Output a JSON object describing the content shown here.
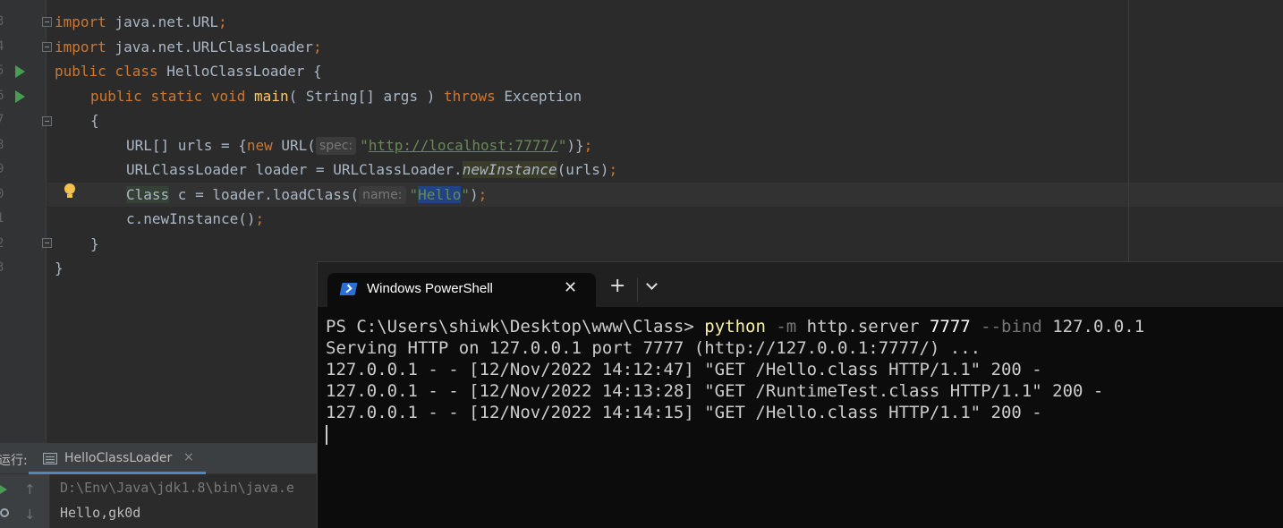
{
  "editor": {
    "line_numbers": [
      "3",
      "4",
      "5",
      "6",
      "7",
      "8",
      "9",
      "0",
      "1",
      "2",
      "3"
    ],
    "code": {
      "l1": {
        "kw": "import",
        "rest": " java.net.URL",
        "semi": ";"
      },
      "l2": {
        "kw": "import",
        "rest": " java.net.URLClassLoader",
        "semi": ";"
      },
      "l3": {
        "kw1": "public",
        "kw2": "class",
        "rest": " HelloClassLoader {"
      },
      "l4": {
        "kw1": "public",
        "kw2": "static",
        "kw3": "void",
        "fn": "main",
        "args": "( String[] args ) ",
        "throws": "throws",
        "rest": " Exception"
      },
      "l5": {
        "text": "{"
      },
      "l6": {
        "pre": "URL[] urls = {",
        "kw": "new",
        "mid": " URL(",
        "hint": "spec:",
        "url": "http://localhost:7777/",
        "quote_open": "\"",
        "quote_close": "\"",
        "post": ")}",
        "semi": ";"
      },
      "l7": {
        "pre": "URLClassLoader loader = URLClassLoader.",
        "method": "newInstance",
        "post": "(urls)",
        "semi": ";"
      },
      "l8": {
        "cls": "Class",
        "mid": " c = loader.loadClass(",
        "hint": "name:",
        "quote_open": "\"",
        "sel": "Hello",
        "quote_close": "\"",
        "post": ")",
        "semi": ";"
      },
      "l9": {
        "pre": "c.newInstance()",
        "semi": ";"
      },
      "l10": {
        "text": "}"
      },
      "l11": {
        "text": "}"
      }
    }
  },
  "run_panel": {
    "title": "运行:",
    "tab_label": "HelloClassLoader",
    "tab_close": "×",
    "up_arrow": "↑",
    "down_arrow": "↓",
    "console_lines": [
      "D:\\Env\\Java\\jdk1.8\\bin\\java.e",
      "Hello,gk0d"
    ]
  },
  "terminal": {
    "tab_title": "Windows PowerShell",
    "tab_close": "✕",
    "new_tab": "+",
    "prompt": "PS C:\\Users\\shiwk\\Desktop\\www\\Class> ",
    "command": "python",
    "arg1_flag": " -m",
    "arg1_val": " http.server ",
    "port": "7777",
    "arg2_flag": " --bind",
    "arg2_val": " 127.0.0.1",
    "output": [
      "Serving HTTP on 127.0.0.1 port 7777 (http://127.0.0.1:7777/) ...",
      "127.0.0.1 - - [12/Nov/2022 14:12:47] \"GET /Hello.class HTTP/1.1\" 200 -",
      "127.0.0.1 - - [12/Nov/2022 14:13:28] \"GET /RuntimeTest.class HTTP/1.1\" 200 -",
      "127.0.0.1 - - [12/Nov/2022 14:14:15] \"GET /Hello.class HTTP/1.1\" 200 -"
    ]
  },
  "colors": {
    "editor_bg": "#2b2b2b",
    "keyword": "#cc7832",
    "function": "#ffc66d",
    "string": "#6a8759",
    "terminal_bg": "#0c0c0c",
    "terminal_command": "#f9f1a5"
  },
  "icons": [
    "run-icon",
    "fold-icon",
    "bulb-icon",
    "powershell-icon",
    "close-icon",
    "plus-icon",
    "chevron-down-icon",
    "rerun-icon",
    "wrench-icon",
    "arrow-up-icon",
    "arrow-down-icon",
    "console-tab-icon"
  ]
}
